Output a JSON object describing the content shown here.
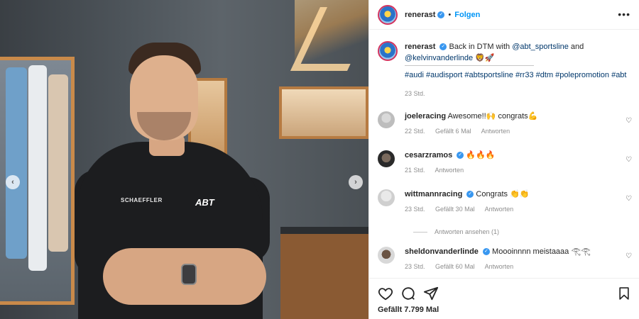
{
  "post": {
    "username": "renerast",
    "follow_label": "Folgen",
    "separator": "•",
    "more_label": "•••",
    "caption": {
      "text_prefix": "Back in DTM with ",
      "mention1": "@abt_sportsline",
      "text_middle": " and",
      "mention2": "@kelvinvanderlinde",
      "emoji": " 🦁🚀",
      "hashtags": "#audi #audisport #abtsportsline #rr33 #dtm #polepromotion #abt",
      "time": "23 Std."
    },
    "likes": "Gefällt 7.799 Mal"
  },
  "photo": {
    "sponsor_left": "SCHAEFFLER",
    "sponsor_right": "ABT",
    "prev_arrow": "‹",
    "next_arrow": "›"
  },
  "comments": [
    {
      "username": "joeleracing",
      "verified": false,
      "text": "Awesome!!🙌 congrats💪",
      "time": "22 Std.",
      "likes": "Gefällt 6 Mal",
      "reply": "Antworten"
    },
    {
      "username": "cesarzramos",
      "verified": true,
      "text": "🔥🔥🔥",
      "time": "21 Std.",
      "likes": "",
      "reply": "Antworten"
    },
    {
      "username": "wittmannracing",
      "verified": true,
      "text": "Congrats 👏👏",
      "time": "23 Std.",
      "likes": "Gefällt 30 Mal",
      "reply": "Antworten"
    },
    {
      "username": "sheldonvanderlinde",
      "verified": true,
      "text": "Moooinnnn meistaaaa 𓂀𓂀",
      "time": "23 Std.",
      "likes": "Gefällt 60 Mal",
      "reply": "Antworten"
    }
  ],
  "view_replies": "Antworten ansehen (1)",
  "icons": {
    "heart": "heart-icon",
    "comment": "comment-icon",
    "share": "share-icon",
    "bookmark": "bookmark-icon",
    "verified": "verified-badge-icon",
    "comment_like": "heart-outline-icon"
  },
  "colors": {
    "accent": "#0095f6",
    "mention": "#00376b",
    "muted": "#8e8e8e",
    "verified": "#3897f0"
  }
}
